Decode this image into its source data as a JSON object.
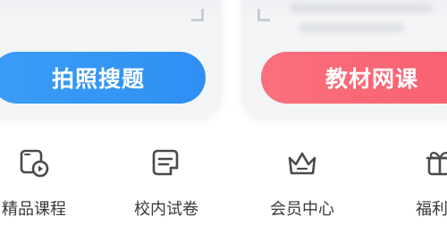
{
  "top_actions": {
    "left_button_label": "拍照搜题",
    "right_button_label": "教材网课"
  },
  "nav": {
    "items": [
      {
        "label": "精品课程",
        "icon": "video-course-icon"
      },
      {
        "label": "校内试卷",
        "icon": "exam-paper-icon"
      },
      {
        "label": "会员中心",
        "icon": "crown-icon"
      },
      {
        "label": "福利中",
        "icon": "gift-icon"
      }
    ]
  },
  "colors": {
    "blue_button": "#3b9df7",
    "red_button": "#f85f70",
    "icon_stroke": "#4a4a4a",
    "label_text": "#3a3a3a",
    "card_bg": "#f3f4f6"
  }
}
